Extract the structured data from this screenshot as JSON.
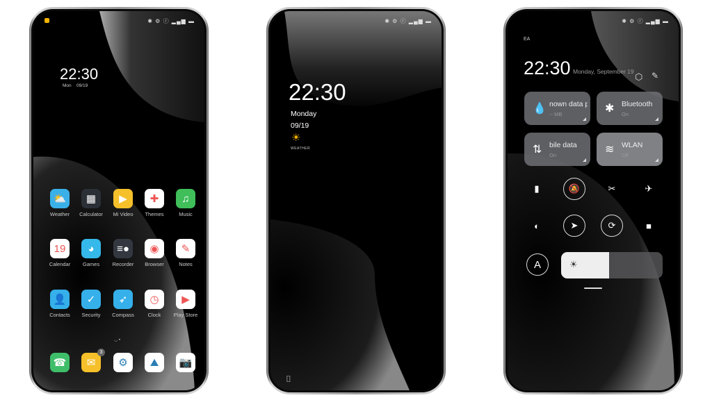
{
  "status_icons": "✱ ⚙ ⓡ ▂▄▆ ▬",
  "home": {
    "clock": "22:30",
    "day": "Mon",
    "date": "09/19",
    "apps": [
      {
        "label": "Weather",
        "icon": "weather-icon",
        "color": "#3ab0e8",
        "glyph": "⛅"
      },
      {
        "label": "Calculator",
        "icon": "calculator-icon",
        "color": "#2b2f36",
        "glyph": "▦"
      },
      {
        "label": "Mi Video",
        "icon": "play-icon",
        "color": "#f5c02a",
        "glyph": "▶"
      },
      {
        "label": "Themes",
        "icon": "themes-icon",
        "color": "#ffffff",
        "glyph": "✚"
      },
      {
        "label": "Music",
        "icon": "music-icon",
        "color": "#3fbe5a",
        "glyph": "♫"
      },
      {
        "label": "Calendar",
        "icon": "calendar-icon",
        "color": "#ffffff",
        "glyph": "19"
      },
      {
        "label": "Games",
        "icon": "games-icon",
        "color": "#35b8ea",
        "glyph": "◕"
      },
      {
        "label": "Recorder",
        "icon": "recorder-icon",
        "color": "#333840",
        "glyph": "≡●"
      },
      {
        "label": "Browser",
        "icon": "browser-icon",
        "color": "#ffffff",
        "glyph": "◉"
      },
      {
        "label": "Notes",
        "icon": "pencil-icon",
        "color": "#ffffff",
        "glyph": "✎"
      },
      {
        "label": "Contacts",
        "icon": "contacts-icon",
        "color": "#35b0ea",
        "glyph": "👤"
      },
      {
        "label": "Security",
        "icon": "shield-icon",
        "color": "#35b0ea",
        "glyph": "✓"
      },
      {
        "label": "Compass",
        "icon": "compass-icon",
        "color": "#35b0ea",
        "glyph": "➶"
      },
      {
        "label": "Clock",
        "icon": "clock-icon",
        "color": "#ffffff",
        "glyph": "◷"
      },
      {
        "label": "Play Store",
        "icon": "play-store-icon",
        "color": "#ffffff",
        "glyph": "▶"
      }
    ],
    "dock": [
      {
        "icon": "phone-icon",
        "color": "#3fbe6a",
        "glyph": "☎"
      },
      {
        "icon": "mail-icon",
        "color": "#f5c02a",
        "glyph": "✉",
        "badge": "3"
      },
      {
        "icon": "settings-icon",
        "color": "#ffffff",
        "glyph": "⚙"
      },
      {
        "icon": "gallery-icon",
        "color": "#ffffff",
        "glyph": "⛰"
      },
      {
        "icon": "camera-icon",
        "color": "#ffffff",
        "glyph": "📷"
      }
    ]
  },
  "lock": {
    "clock": "22:30",
    "day": "Monday",
    "date": "09/19",
    "weather_label": "WEATHER"
  },
  "control": {
    "carrier": "EA",
    "clock": "22:30",
    "date": "Monday, September 19",
    "tiles": [
      {
        "title": "nown data pl",
        "sub": "-- MB",
        "icon": "droplet-icon",
        "glyph": "💧"
      },
      {
        "title": "Bluetooth",
        "sub": "On",
        "icon": "bluetooth-icon",
        "glyph": "✱"
      },
      {
        "title": "bile data",
        "sub": "On",
        "icon": "mobile-data-icon",
        "glyph": "⇅"
      },
      {
        "title": "WLAN",
        "sub": "Off",
        "icon": "wifi-icon",
        "glyph": "≋"
      }
    ],
    "brightness_percent": 47,
    "auto_brightness_label": "A"
  }
}
